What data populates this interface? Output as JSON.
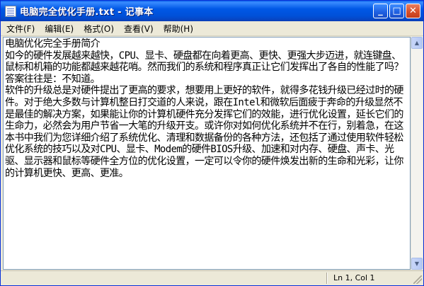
{
  "window": {
    "title": "电脑完全优化手册.txt - 记事本",
    "buttons": {
      "minimize": "_",
      "maximize": "□",
      "close": "✕"
    }
  },
  "menu": {
    "items": [
      {
        "label": "文件(F)"
      },
      {
        "label": "编辑(E)"
      },
      {
        "label": "格式(O)"
      },
      {
        "label": "查看(V)"
      },
      {
        "label": "帮助(H)"
      }
    ]
  },
  "editor": {
    "content": "电脑优化完全手册简介\n如今的硬件发展越来越快，CPU、显卡、硬盘都在向着更高、更快、更强大步迈进，就连键盘、鼠标和机箱的功能都越来越花哨。然而我们的系统和程序真正让它们发挥出了各自的性能了吗？答案往往是：不知道。\n软件的升级总是对硬件提出了更高的要求，想要用上更好的软件，就得多花钱升级已经过时的硬件。对于绝大多数与计算机整日打交道的人来说，跟在Intel和微软后面疲于奔命的升级显然不是最佳的解决方案，如果能让你的计算机硬件充分发挥它们的效能，进行优化设置，延长它们的生命力，必然会为用户节省一大笔的升级开支。或许你对如何优化系统并不在行，别着急，在这本书中我们为您详细介绍了系统优化、清理和数据备份的各种方法，还包括了通过使用软件轻松优化系统的技巧以及对CPU、显卡、Modem的硬件BIOS升级、加速和对内存、硬盘、声卡、光驱、显示器和鼠标等硬件全方位的优化设置，一定可以令你的硬件焕发出新的生命和光彩，让你的计算机更快、更高、更准。"
  },
  "statusbar": {
    "position": "Ln 1, Col 1"
  }
}
